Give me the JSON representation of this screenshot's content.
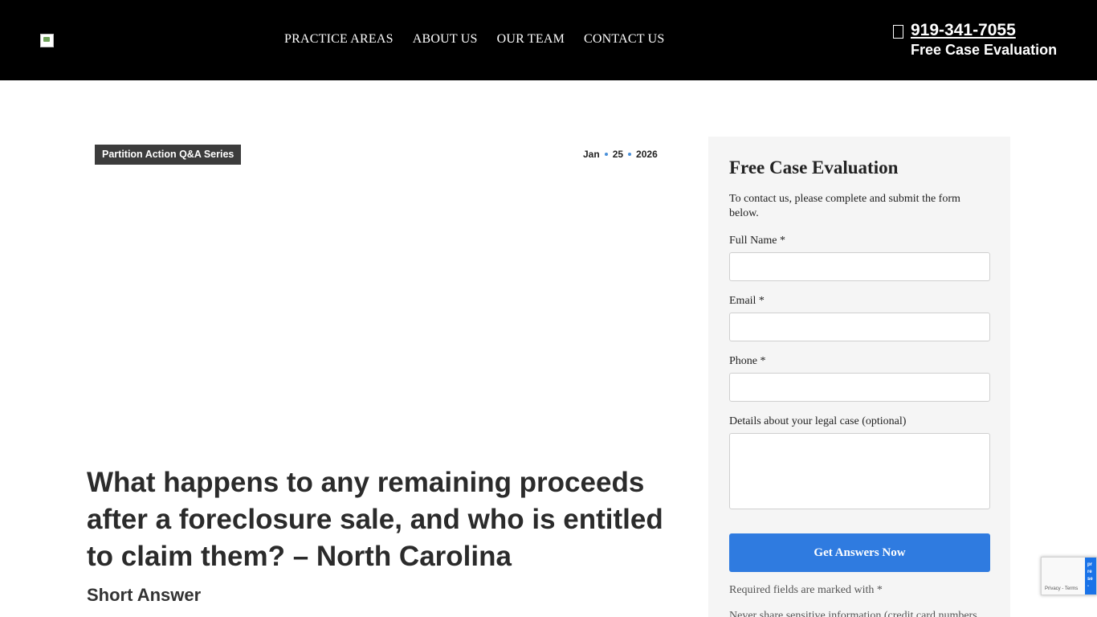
{
  "header": {
    "nav": [
      "PRACTICE AREAS",
      "ABOUT US",
      "OUR TEAM",
      "CONTACT US"
    ],
    "phone": "919-341-7055",
    "phone_subtitle": "Free Case Evaluation",
    "logo_icon": "broken-image-icon",
    "phone_icon": "phone-icon"
  },
  "article": {
    "tag": "Partition Action Q&A Series",
    "date": {
      "month": "Jan",
      "day": "25",
      "year": "2026"
    },
    "title": "What happens to any remaining proceeds after a foreclosure sale, and who is entitled to claim them? – North Carolina",
    "section_heading": "Short Answer"
  },
  "form": {
    "title": "Free Case Evaluation",
    "intro": "To contact us, please complete and submit the form below.",
    "fields": [
      {
        "label": "Full Name *",
        "value": ""
      },
      {
        "label": "Email *",
        "value": ""
      },
      {
        "label": "Phone *",
        "value": ""
      },
      {
        "label": "Details about your legal case (optional)",
        "value": ""
      }
    ],
    "submit_label": "Get Answers Now",
    "required_note": "Required fields are marked with *",
    "warning_note": "Never share sensitive information (credit card numbers"
  },
  "recaptcha": {
    "badge_lines": [
      "pr",
      "re",
      "se",
      "-"
    ],
    "links": "Privacy - Terms"
  },
  "colors": {
    "header_bg": "#000000",
    "accent_blue": "#2f7be0",
    "tag_bg": "#3c3c3c",
    "sidebar_bg": "#f5f5f5"
  }
}
